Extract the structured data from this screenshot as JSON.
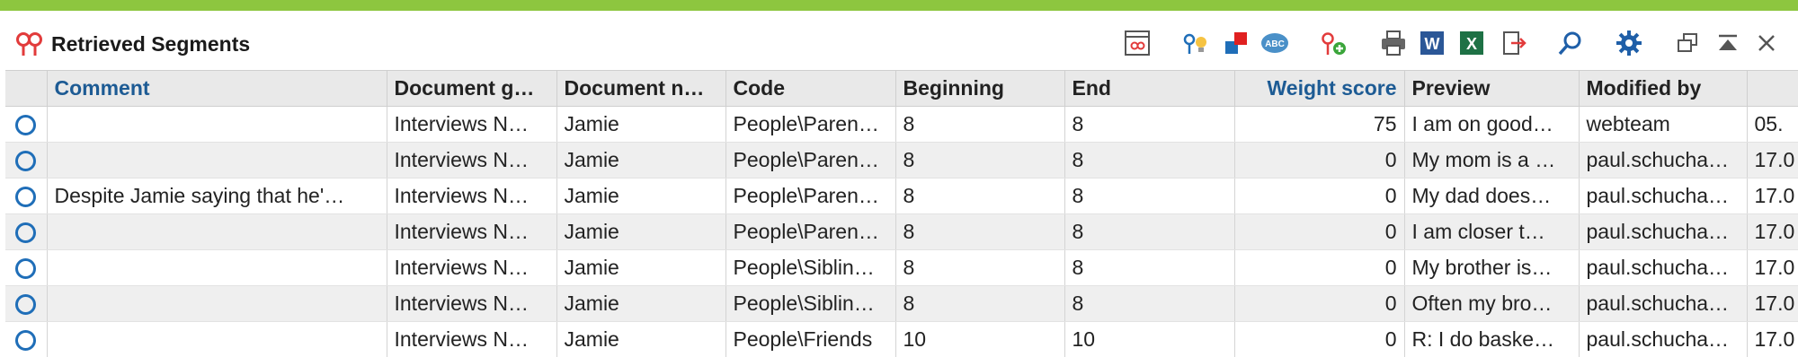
{
  "window": {
    "title": "Retrieved Segments",
    "accent_color": "#8dc63f"
  },
  "toolbar": {
    "icons": [
      "code-overview-icon",
      "smart-coding-icon",
      "color-code-icon",
      "spellcheck-icon",
      "add-code-icon",
      "print-icon",
      "word-export-icon",
      "excel-export-icon",
      "export-icon",
      "search-icon",
      "settings-icon",
      "undock-icon",
      "collapse-icon",
      "close-icon"
    ]
  },
  "table": {
    "columns": [
      {
        "label": "",
        "sorted": false
      },
      {
        "label": "Comment",
        "sorted": true
      },
      {
        "label": "Document g…",
        "sorted": false
      },
      {
        "label": "Document n…",
        "sorted": false
      },
      {
        "label": "Code",
        "sorted": false
      },
      {
        "label": "Beginning",
        "sorted": false
      },
      {
        "label": "End",
        "sorted": false
      },
      {
        "label": "Weight score",
        "sorted": true
      },
      {
        "label": "Preview",
        "sorted": false
      },
      {
        "label": "Modified by",
        "sorted": false
      },
      {
        "label": "",
        "sorted": false
      }
    ],
    "rows": [
      {
        "comment": "",
        "doc_group": "Interviews N…",
        "doc_name": "Jamie",
        "code": "People\\Paren…",
        "beginning": "8",
        "end": "8",
        "weight": "75",
        "preview": "I am on good…",
        "modified_by": "webteam",
        "modified": "05."
      },
      {
        "comment": "",
        "doc_group": "Interviews N…",
        "doc_name": "Jamie",
        "code": "People\\Paren…",
        "beginning": "8",
        "end": "8",
        "weight": "0",
        "preview": "My mom is a …",
        "modified_by": "paul.schucha…",
        "modified": "17.0"
      },
      {
        "comment": "Despite Jamie saying that he'…",
        "doc_group": "Interviews N…",
        "doc_name": "Jamie",
        "code": "People\\Paren…",
        "beginning": "8",
        "end": "8",
        "weight": "0",
        "preview": "My dad does…",
        "modified_by": "paul.schucha…",
        "modified": "17.0"
      },
      {
        "comment": "",
        "doc_group": "Interviews N…",
        "doc_name": "Jamie",
        "code": "People\\Paren…",
        "beginning": "8",
        "end": "8",
        "weight": "0",
        "preview": "I am closer t…",
        "modified_by": "paul.schucha…",
        "modified": "17.0"
      },
      {
        "comment": "",
        "doc_group": "Interviews N…",
        "doc_name": "Jamie",
        "code": "People\\Siblin…",
        "beginning": "8",
        "end": "8",
        "weight": "0",
        "preview": "My brother is…",
        "modified_by": "paul.schucha…",
        "modified": "17.0"
      },
      {
        "comment": "",
        "doc_group": "Interviews N…",
        "doc_name": "Jamie",
        "code": "People\\Siblin…",
        "beginning": "8",
        "end": "8",
        "weight": "0",
        "preview": "Often my bro…",
        "modified_by": "paul.schucha…",
        "modified": "17.0"
      },
      {
        "comment": "",
        "doc_group": "Interviews N…",
        "doc_name": "Jamie",
        "code": "People\\Friends",
        "beginning": "10",
        "end": "10",
        "weight": "0",
        "preview": "R: I do baske…",
        "modified_by": "paul.schucha…",
        "modified": "17.0"
      }
    ]
  }
}
